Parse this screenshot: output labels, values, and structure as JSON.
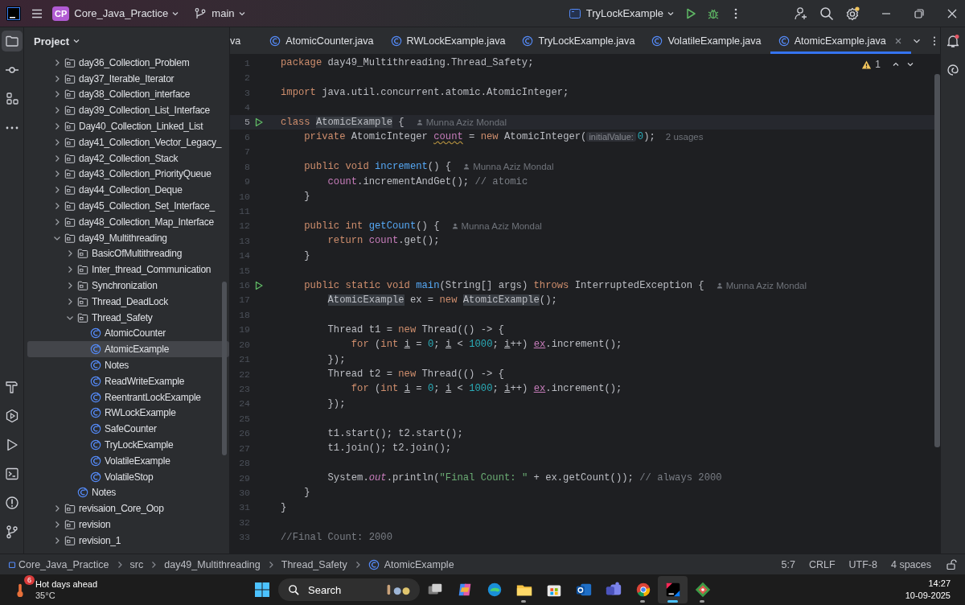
{
  "titlebar": {
    "project_badge": "CP",
    "project": "Core_Java_Practice",
    "branch": "main",
    "run_config": "TryLockExample"
  },
  "left_tools": [
    {
      "kind": "project",
      "selected": true
    },
    {
      "kind": "commit",
      "selected": false
    },
    {
      "kind": "structure",
      "selected": false
    },
    {
      "kind": "more",
      "selected": false
    }
  ],
  "left_tools_bottom": [
    {
      "kind": "build",
      "selected": false
    },
    {
      "kind": "services",
      "selected": false
    },
    {
      "kind": "run",
      "selected": false
    },
    {
      "kind": "terminal",
      "selected": false
    },
    {
      "kind": "problems",
      "selected": false
    },
    {
      "kind": "git",
      "selected": false
    }
  ],
  "project": {
    "title": "Project",
    "items": [
      {
        "label": "day36_Collection_Problem",
        "kind": "folder",
        "expanded": false,
        "selected": false
      },
      {
        "label": "day37_Iterable_Iterator",
        "kind": "folder",
        "expanded": false,
        "selected": false
      },
      {
        "label": "day38_Collection_interface",
        "kind": "folder",
        "expanded": false,
        "selected": false
      },
      {
        "label": "day39_Collection_List_Interface",
        "kind": "folder",
        "expanded": false,
        "selected": false
      },
      {
        "label": "Day40_Collection_Linked_List",
        "kind": "folder",
        "expanded": false,
        "selected": false
      },
      {
        "label": "day41_Collection_Vector_Legacy_",
        "kind": "folder",
        "expanded": false,
        "selected": false
      },
      {
        "label": "day42_Collection_Stack",
        "kind": "folder",
        "expanded": false,
        "selected": false
      },
      {
        "label": "day43_Collection_PriorityQueue",
        "kind": "folder",
        "expanded": false,
        "selected": false
      },
      {
        "label": "day44_Collection_Deque",
        "kind": "folder",
        "expanded": false,
        "selected": false
      },
      {
        "label": "day45_Collection_Set_Interface_",
        "kind": "folder",
        "expanded": false,
        "selected": false
      },
      {
        "label": "day48_Collection_Map_Interface",
        "kind": "folder",
        "expanded": false,
        "selected": false
      },
      {
        "label": "day49_Multithreading",
        "kind": "folder",
        "expanded": true,
        "selected": false,
        "children": [
          {
            "label": "BasicOfMultithreading",
            "kind": "folder",
            "expanded": false,
            "selected": false
          },
          {
            "label": "Inter_thread_Communication",
            "kind": "folder",
            "expanded": false,
            "selected": false
          },
          {
            "label": "Synchronization",
            "kind": "folder",
            "expanded": false,
            "selected": false
          },
          {
            "label": "Thread_DeadLock",
            "kind": "folder",
            "expanded": false,
            "selected": false
          },
          {
            "label": "Thread_Safety",
            "kind": "folder",
            "expanded": true,
            "selected": false,
            "children": [
              {
                "label": "AtomicCounter",
                "kind": "class",
                "selected": false
              },
              {
                "label": "AtomicExample",
                "kind": "class",
                "selected": true
              },
              {
                "label": "Notes",
                "kind": "class",
                "selected": false
              },
              {
                "label": "ReadWriteExample",
                "kind": "class",
                "selected": false
              },
              {
                "label": "ReentrantLockExample",
                "kind": "class",
                "selected": false
              },
              {
                "label": "RWLockExample",
                "kind": "class",
                "selected": false
              },
              {
                "label": "SafeCounter",
                "kind": "class",
                "selected": false
              },
              {
                "label": "TryLockExample",
                "kind": "class",
                "selected": false
              },
              {
                "label": "VolatileExample",
                "kind": "class",
                "selected": false
              },
              {
                "label": "VolatileStop",
                "kind": "class",
                "selected": false
              }
            ]
          },
          {
            "label": "Notes",
            "kind": "class",
            "selected": false
          }
        ]
      },
      {
        "label": "revisaion_Core_Oop",
        "kind": "folder",
        "expanded": false,
        "selected": false
      },
      {
        "label": "revision",
        "kind": "folder",
        "expanded": false,
        "selected": false
      },
      {
        "label": "revision_1",
        "kind": "folder",
        "expanded": false,
        "selected": false
      }
    ]
  },
  "tabs": [
    {
      "label": "va",
      "kind": "cut",
      "selected": false
    },
    {
      "label": "AtomicCounter.java",
      "kind": "class",
      "selected": false
    },
    {
      "label": "RWLockExample.java",
      "kind": "class",
      "selected": false
    },
    {
      "label": "TryLockExample.java",
      "kind": "class",
      "selected": false
    },
    {
      "label": "VolatileExample.java",
      "kind": "class",
      "selected": false
    },
    {
      "label": "AtomicExample.java",
      "kind": "class",
      "selected": true
    }
  ],
  "editor": {
    "warnings": "1",
    "lines": [
      {
        "no": "1",
        "segments": [
          {
            "kind": "code",
            "tokens": [
              {
                "t": "package ",
                "kind": "kw"
              },
              {
                "t": "day49_Multithreading.Thread_Safety;",
                "kind": "p"
              }
            ]
          }
        ]
      },
      {
        "no": "2"
      },
      {
        "no": "3",
        "segments": [
          {
            "kind": "code",
            "tokens": [
              {
                "t": "import ",
                "kind": "kw"
              },
              {
                "t": "java.util.concurrent.atomic.AtomicInteger;",
                "kind": "p"
              }
            ]
          }
        ]
      },
      {
        "no": "4"
      },
      {
        "no": "5",
        "current": true,
        "run": true,
        "segments": [
          {
            "kind": "code",
            "tokens": [
              {
                "t": "class ",
                "kind": "kw"
              },
              {
                "t": "AtomicExample",
                "kind": "ref"
              },
              {
                "t": " {",
                "kind": "p"
              }
            ]
          },
          {
            "kind": "author",
            "text": "Munna Aziz Mondal"
          }
        ]
      },
      {
        "no": "6",
        "segments": [
          {
            "kind": "code",
            "tokens": [
              {
                "t": "    private ",
                "kind": "kw"
              },
              {
                "t": "AtomicInteger ",
                "kind": "p"
              },
              {
                "t": "count",
                "kind": "warn"
              },
              {
                "t": " = ",
                "kind": "p"
              },
              {
                "t": "new ",
                "kind": "kw"
              },
              {
                "t": "AtomicInteger(",
                "kind": "p"
              }
            ]
          },
          {
            "kind": "inlay",
            "text": "initialValue:"
          },
          {
            "kind": "code",
            "tokens": [
              {
                "t": "0",
                "kind": "num"
              },
              {
                "t": ");",
                "kind": "p"
              }
            ]
          },
          {
            "kind": "usages",
            "text": "2 usages"
          }
        ]
      },
      {
        "no": "7"
      },
      {
        "no": "8",
        "segments": [
          {
            "kind": "code",
            "tokens": [
              {
                "t": "    public void ",
                "kind": "kw"
              },
              {
                "t": "increment",
                "kind": "fn"
              },
              {
                "t": "() {",
                "kind": "p"
              }
            ]
          },
          {
            "kind": "author",
            "text": "Munna Aziz Mondal"
          }
        ]
      },
      {
        "no": "9",
        "segments": [
          {
            "kind": "code",
            "tokens": [
              {
                "t": "        count",
                "kind": "field"
              },
              {
                "t": ".incrementAndGet(); ",
                "kind": "p"
              },
              {
                "t": "// atomic",
                "kind": "cmt"
              }
            ]
          }
        ]
      },
      {
        "no": "10",
        "segments": [
          {
            "kind": "code",
            "tokens": [
              {
                "t": "    }",
                "kind": "p"
              }
            ]
          }
        ]
      },
      {
        "no": "11"
      },
      {
        "no": "12",
        "segments": [
          {
            "kind": "code",
            "tokens": [
              {
                "t": "    public int ",
                "kind": "kw"
              },
              {
                "t": "getCount",
                "kind": "fn"
              },
              {
                "t": "() {",
                "kind": "p"
              }
            ]
          },
          {
            "kind": "author",
            "text": "Munna Aziz Mondal"
          }
        ]
      },
      {
        "no": "13",
        "segments": [
          {
            "kind": "code",
            "tokens": [
              {
                "t": "        return ",
                "kind": "kw"
              },
              {
                "t": "count",
                "kind": "field"
              },
              {
                "t": ".get();",
                "kind": "p"
              }
            ]
          }
        ]
      },
      {
        "no": "14",
        "segments": [
          {
            "kind": "code",
            "tokens": [
              {
                "t": "    }",
                "kind": "p"
              }
            ]
          }
        ]
      },
      {
        "no": "15"
      },
      {
        "no": "16",
        "run": true,
        "segments": [
          {
            "kind": "code",
            "tokens": [
              {
                "t": "    public static void ",
                "kind": "kw"
              },
              {
                "t": "main",
                "kind": "fn"
              },
              {
                "t": "(String[] args) ",
                "kind": "p"
              },
              {
                "t": "throws ",
                "kind": "kw"
              },
              {
                "t": "InterruptedException {",
                "kind": "p"
              }
            ]
          },
          {
            "kind": "author",
            "text": "Munna Aziz Mondal"
          }
        ]
      },
      {
        "no": "17",
        "segments": [
          {
            "kind": "code",
            "tokens": [
              {
                "t": "        AtomicExample",
                "kind": "ref"
              },
              {
                "t": " ex = ",
                "kind": "p"
              },
              {
                "t": "new ",
                "kind": "kw"
              },
              {
                "t": "AtomicExample",
                "kind": "ref"
              },
              {
                "t": "();",
                "kind": "p"
              }
            ]
          }
        ]
      },
      {
        "no": "18"
      },
      {
        "no": "19",
        "segments": [
          {
            "kind": "code",
            "tokens": [
              {
                "t": "        Thread t1 = ",
                "kind": "p"
              },
              {
                "t": "new ",
                "kind": "kw"
              },
              {
                "t": "Thread(() -> {",
                "kind": "p"
              }
            ]
          }
        ]
      },
      {
        "no": "20",
        "segments": [
          {
            "kind": "code",
            "tokens": [
              {
                "t": "            for ",
                "kind": "kw"
              },
              {
                "t": "(",
                "kind": "p"
              },
              {
                "t": "int ",
                "kind": "kw"
              },
              {
                "t": "i",
                "kind": "var"
              },
              {
                "t": " = ",
                "kind": "p"
              },
              {
                "t": "0",
                "kind": "num"
              },
              {
                "t": "; ",
                "kind": "p"
              },
              {
                "t": "i",
                "kind": "var"
              },
              {
                "t": " < ",
                "kind": "p"
              },
              {
                "t": "1000",
                "kind": "num"
              },
              {
                "t": "; ",
                "kind": "p"
              },
              {
                "t": "i",
                "kind": "var"
              },
              {
                "t": "++) ",
                "kind": "p"
              },
              {
                "t": "ex",
                "kind": "fieldu"
              },
              {
                "t": ".increment();",
                "kind": "p"
              }
            ]
          }
        ]
      },
      {
        "no": "21",
        "segments": [
          {
            "kind": "code",
            "tokens": [
              {
                "t": "        });",
                "kind": "p"
              }
            ]
          }
        ]
      },
      {
        "no": "22",
        "segments": [
          {
            "kind": "code",
            "tokens": [
              {
                "t": "        Thread t2 = ",
                "kind": "p"
              },
              {
                "t": "new ",
                "kind": "kw"
              },
              {
                "t": "Thread(() -> {",
                "kind": "p"
              }
            ]
          }
        ]
      },
      {
        "no": "23",
        "segments": [
          {
            "kind": "code",
            "tokens": [
              {
                "t": "            for ",
                "kind": "kw"
              },
              {
                "t": "(",
                "kind": "p"
              },
              {
                "t": "int ",
                "kind": "kw"
              },
              {
                "t": "i",
                "kind": "var"
              },
              {
                "t": " = ",
                "kind": "p"
              },
              {
                "t": "0",
                "kind": "num"
              },
              {
                "t": "; ",
                "kind": "p"
              },
              {
                "t": "i",
                "kind": "var"
              },
              {
                "t": " < ",
                "kind": "p"
              },
              {
                "t": "1000",
                "kind": "num"
              },
              {
                "t": "; ",
                "kind": "p"
              },
              {
                "t": "i",
                "kind": "var"
              },
              {
                "t": "++) ",
                "kind": "p"
              },
              {
                "t": "ex",
                "kind": "fieldu"
              },
              {
                "t": ".increment();",
                "kind": "p"
              }
            ]
          }
        ]
      },
      {
        "no": "24",
        "segments": [
          {
            "kind": "code",
            "tokens": [
              {
                "t": "        });",
                "kind": "p"
              }
            ]
          }
        ]
      },
      {
        "no": "25"
      },
      {
        "no": "26",
        "segments": [
          {
            "kind": "code",
            "tokens": [
              {
                "t": "        t1.start(); t2.start();",
                "kind": "p"
              }
            ]
          }
        ]
      },
      {
        "no": "27",
        "segments": [
          {
            "kind": "code",
            "tokens": [
              {
                "t": "        t1.join(); t2.join();",
                "kind": "p"
              }
            ]
          }
        ]
      },
      {
        "no": "28"
      },
      {
        "no": "29",
        "segments": [
          {
            "kind": "code",
            "tokens": [
              {
                "t": "        System.",
                "kind": "p"
              },
              {
                "t": "out",
                "kind": "ital"
              },
              {
                "t": ".println(",
                "kind": "p"
              },
              {
                "t": "\"Final Count: \"",
                "kind": "str"
              },
              {
                "t": " + ex.getCount()); ",
                "kind": "p"
              },
              {
                "t": "// always 2000",
                "kind": "cmt"
              }
            ]
          }
        ]
      },
      {
        "no": "30",
        "segments": [
          {
            "kind": "code",
            "tokens": [
              {
                "t": "    }",
                "kind": "p"
              }
            ]
          }
        ]
      },
      {
        "no": "31",
        "segments": [
          {
            "kind": "code",
            "tokens": [
              {
                "t": "}",
                "kind": "p"
              }
            ]
          }
        ]
      },
      {
        "no": "32"
      },
      {
        "no": "33",
        "segments": [
          {
            "kind": "code",
            "tokens": [
              {
                "t": "//Final Count: 2000",
                "kind": "cmt"
              }
            ]
          }
        ]
      }
    ]
  },
  "status_bar": {
    "breadcrumbs": [
      {
        "label": "Core_Java_Practice",
        "kind": "module"
      },
      {
        "label": "src",
        "kind": "folder"
      },
      {
        "label": "day49_Multithreading",
        "kind": "folder"
      },
      {
        "label": "Thread_Safety",
        "kind": "folder"
      },
      {
        "label": "AtomicExample",
        "kind": "class"
      }
    ],
    "position": "5:7",
    "line_separator": "CRLF",
    "encoding": "UTF-8",
    "indent": "4 spaces"
  },
  "taskbar": {
    "weather": {
      "badge": "6",
      "title": "Hot days ahead",
      "temperature": "35°C"
    },
    "search": "Search",
    "apps": [
      {
        "kind": "taskview",
        "running": false,
        "active": false
      },
      {
        "kind": "copilot",
        "running": false,
        "active": false
      },
      {
        "kind": "edge",
        "running": false,
        "active": false
      },
      {
        "kind": "explorer",
        "running": true,
        "active": false
      },
      {
        "kind": "store",
        "running": false,
        "active": false
      },
      {
        "kind": "outlook",
        "running": false,
        "active": false
      },
      {
        "kind": "teams",
        "running": false,
        "active": false
      },
      {
        "kind": "chrome",
        "running": true,
        "active": false
      },
      {
        "kind": "intellij",
        "running": true,
        "active": true
      },
      {
        "kind": "gitdiamond",
        "running": true,
        "active": false
      }
    ],
    "time": "14:27",
    "date": "10-09-2025"
  }
}
